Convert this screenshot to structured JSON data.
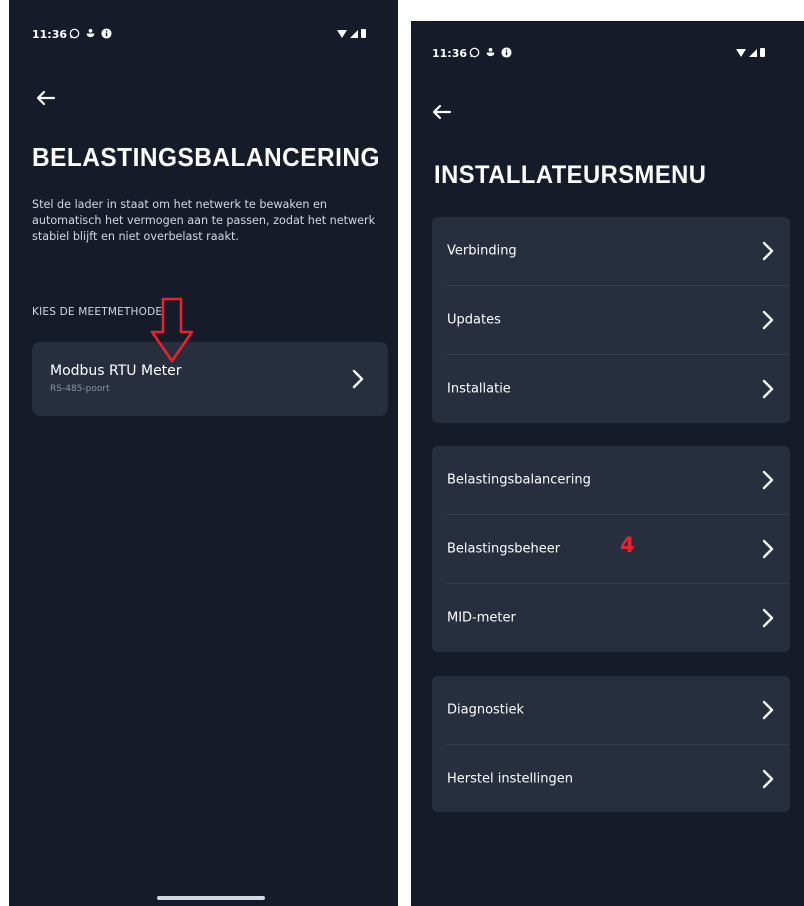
{
  "status_bar": {
    "time": "11:36",
    "left_icons": [
      "whatsapp-icon",
      "person-shield-icon",
      "info-icon"
    ],
    "right_icons": [
      "wifi-icon",
      "signal-icon",
      "battery-icon"
    ]
  },
  "left_screen": {
    "title": "BELASTINGSBALANCERING",
    "description": "Stel de lader in staat om het netwerk te bewaken en automatisch het vermogen aan te passen, zodat het netwerk stabiel blijft en niet overbelast raakt.",
    "section_label": "KIES DE MEETMETHODE",
    "option": {
      "title": "Modbus RTU Meter",
      "subtitle": "RS-485-poort"
    }
  },
  "right_screen": {
    "title": "INSTALLATEURSMENU",
    "groups": [
      {
        "items": [
          {
            "label": "Verbinding"
          },
          {
            "label": "Updates"
          },
          {
            "label": "Installatie"
          }
        ]
      },
      {
        "items": [
          {
            "label": "Belastingsbalancering"
          },
          {
            "label": "Belastingsbeheer"
          },
          {
            "label": "MID-meter"
          }
        ]
      },
      {
        "items": [
          {
            "label": "Diagnostiek"
          },
          {
            "label": "Herstel instellingen"
          }
        ]
      }
    ]
  },
  "annotation": {
    "number": "4",
    "color": "#e8232d"
  },
  "colors": {
    "background": "#161b2a",
    "card": "#272e3e",
    "text": "#ffffff",
    "muted": "#8b92a3"
  }
}
